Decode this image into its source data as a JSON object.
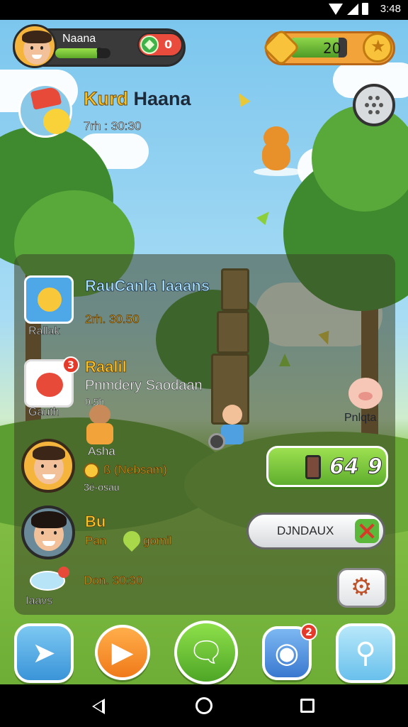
{
  "status_bar": {
    "time": "3:48"
  },
  "profile": {
    "name": "Naana",
    "xp_value": "0",
    "xp_progress": 0.75,
    "gem_count": "0"
  },
  "currency": {
    "count": "20",
    "progress": 0.85
  },
  "main_player": {
    "title_gold": "Kurd",
    "title_rest": "Haana",
    "subtitle": "7rh : 30:30"
  },
  "list": [
    {
      "title": "RauCanla Iaaans",
      "text": "2rh. 30.50",
      "icon_caption": "Rallak"
    },
    {
      "title": "Raalil",
      "text": "Pnmdery Saodaan",
      "subtext": "0.5h",
      "icon_caption": "Gauth"
    },
    {
      "title": "Asha",
      "text": "ß (Nebsam)",
      "subtext": "3é-osau"
    },
    {
      "title": "Bu",
      "text": "Pan",
      "text2": "gomil"
    },
    {
      "title": "Iaavs",
      "text": "Don. 30:30"
    }
  ],
  "side": {
    "character_label": "Pnlqta",
    "score_value": "64",
    "score_suffix": "9",
    "action_label": "DJNDAUX"
  },
  "nav_badges": {
    "chat": "2"
  },
  "colors": {
    "accent_green": "#5fae2e",
    "accent_orange": "#f2a33a",
    "badge_red": "#e53a2a"
  }
}
